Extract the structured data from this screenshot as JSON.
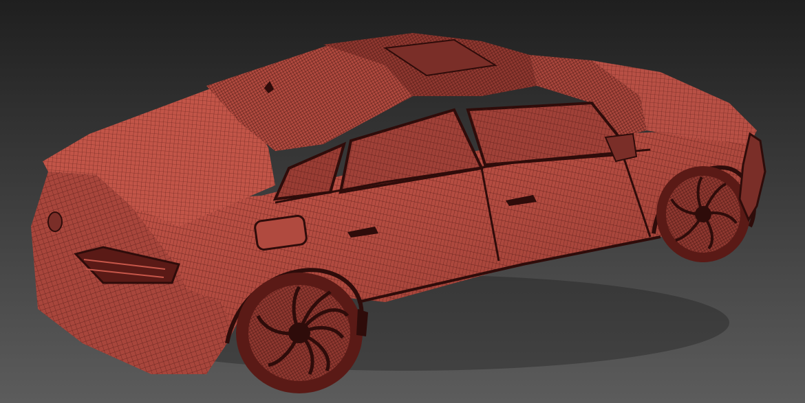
{
  "viewport": {
    "render_mode": "wireframe-shaded",
    "view": "perspective",
    "subject": "car-model"
  },
  "colors": {
    "bg_top": "#1f1f1f",
    "bg_bottom": "#5c5c5c",
    "mesh_fill": "#b04a3f",
    "mesh_fill_light": "#c8574a",
    "mesh_fill_dark": "#8f3830",
    "wire": "#4a1512",
    "deep": "#2e0c0a"
  }
}
